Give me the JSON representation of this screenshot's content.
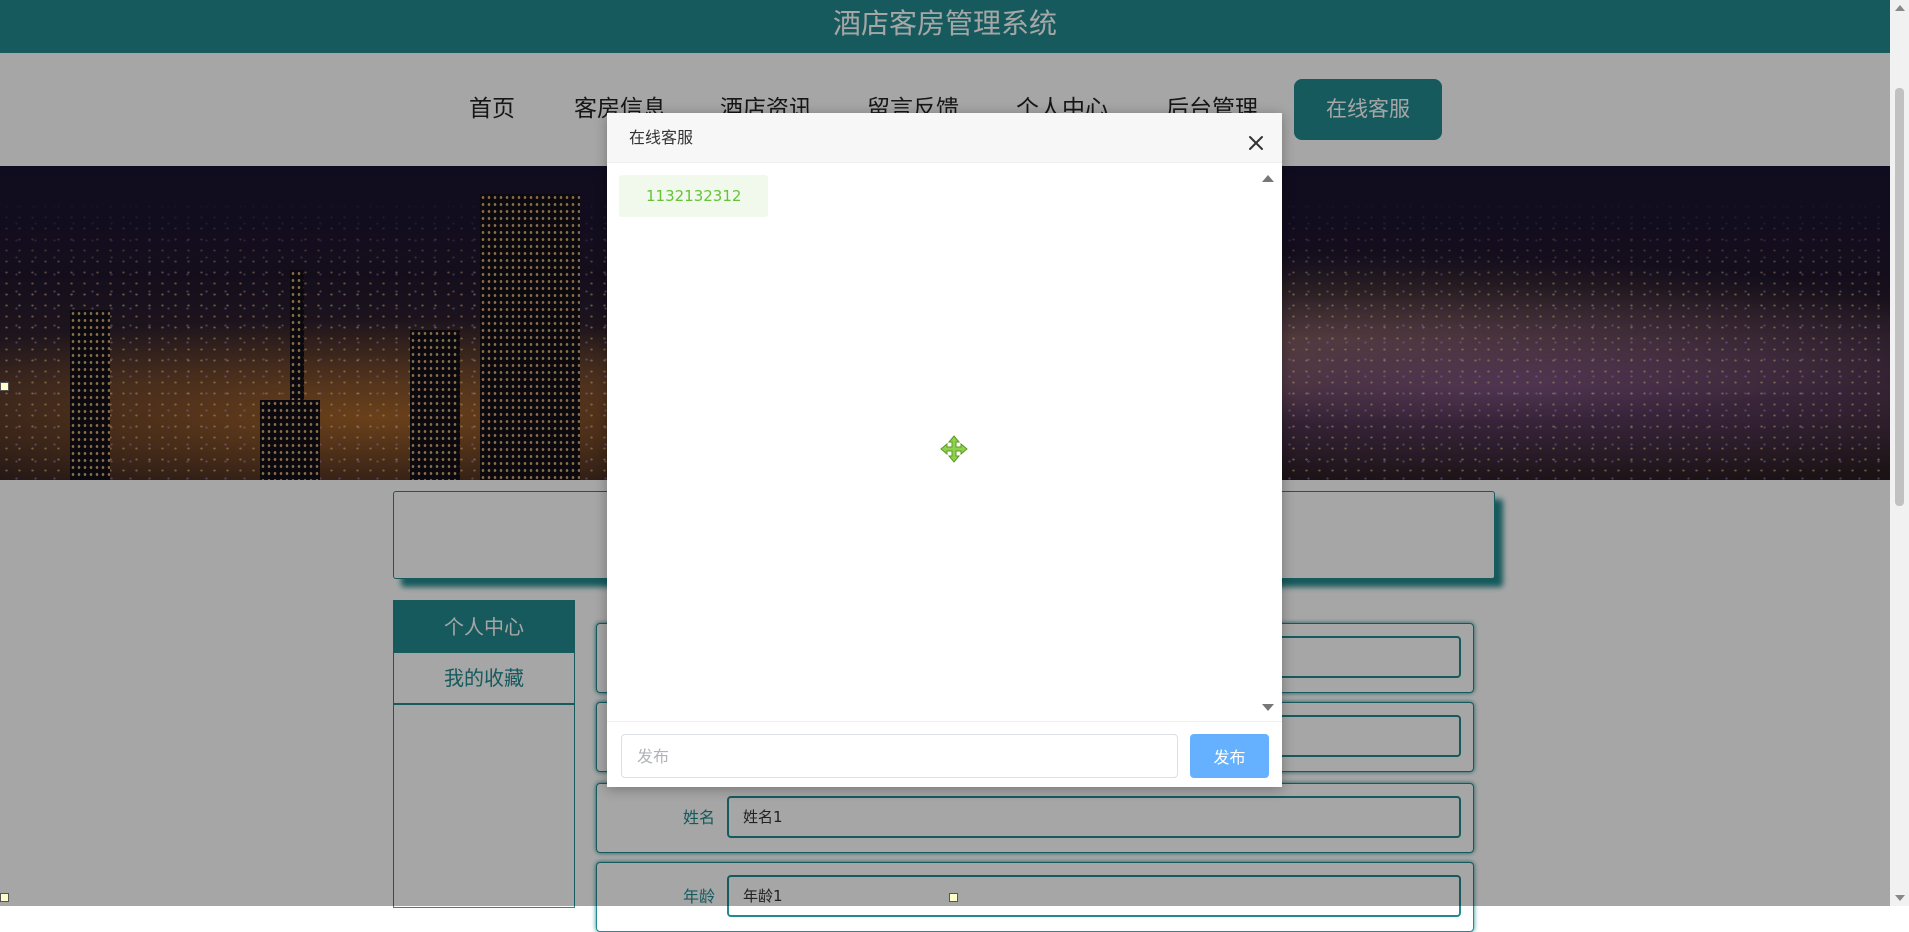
{
  "header": {
    "title": "酒店客房管理系统"
  },
  "nav": {
    "items": [
      "首页",
      "客房信息",
      "酒店资讯",
      "留言反馈",
      "个人中心",
      "后台管理"
    ],
    "cta_label": "在线客服"
  },
  "side_menu": {
    "title": "个人中心",
    "items": [
      "我的收藏"
    ]
  },
  "form": {
    "rows": [
      {
        "label": "",
        "value": ""
      },
      {
        "label": "",
        "value": ""
      },
      {
        "label": "姓名",
        "value": "姓名1"
      },
      {
        "label": "年龄",
        "value": "年龄1"
      }
    ]
  },
  "dialog": {
    "title": "在线客服",
    "messages": [
      "1132132312"
    ],
    "input_placeholder": "发布",
    "send_label": "发布"
  },
  "colors": {
    "brand": "#238a8f",
    "send_button": "#66b1ff",
    "message_text": "#67c23a",
    "message_bg": "#f0f9eb"
  },
  "icons": [
    "close-icon",
    "move-icon",
    "scroll-up-icon",
    "scroll-down-icon"
  ]
}
